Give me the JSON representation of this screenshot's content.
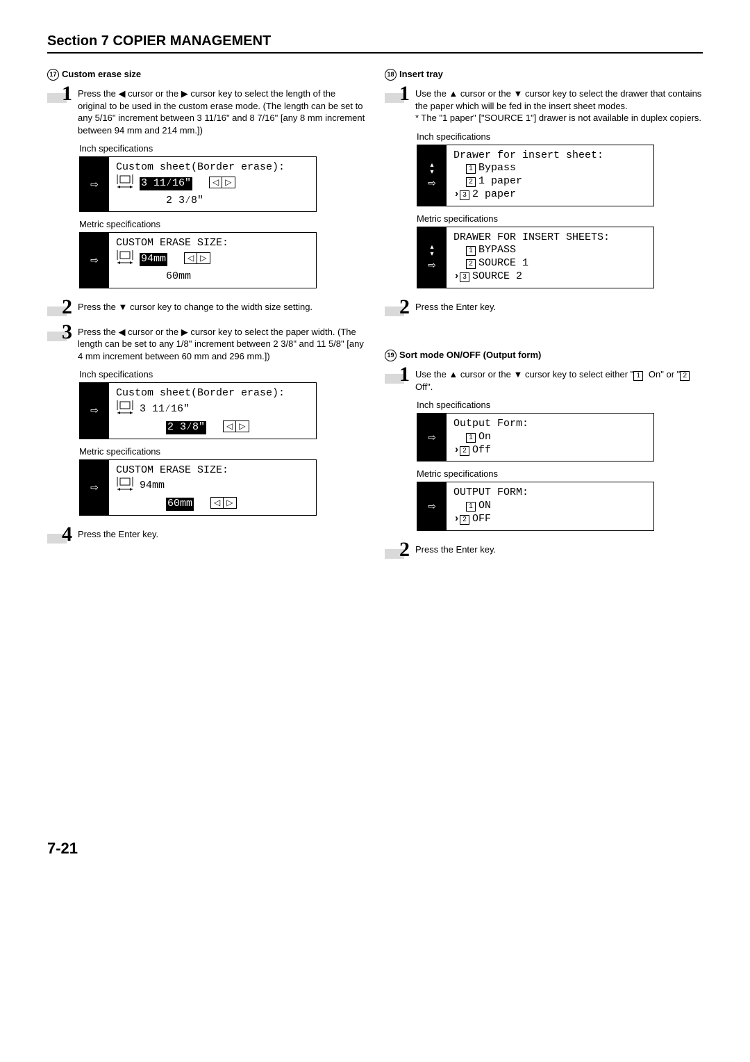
{
  "header": {
    "title": "Section 7  COPIER MANAGEMENT"
  },
  "page_number": "7-21",
  "left": {
    "subhead_num": "17",
    "subhead_text": "Custom erase size",
    "step1": "Press the ◀ cursor or the ▶ cursor key to select the length of the original to be used in the custom erase mode. (The length can be set to any 5/16\" increment between 3 11/16\" and 8 7/16\" [any 8 mm increment between 94 mm and 214 mm.])",
    "spec_inch": "Inch specifications",
    "lcd1_title": "Custom sheet(Border erase):",
    "lcd1_v1": "3 11⁄16\"",
    "lcd1_v2": "2 3⁄8\"",
    "spec_metric": "Metric specifications",
    "lcd2_title": "CUSTOM ERASE SIZE:",
    "lcd2_v1": "94mm",
    "lcd2_v2": "60mm",
    "step2": "Press the ▼ cursor key to change to the width size setting.",
    "step3": "Press the ◀ cursor or the ▶ cursor key to select the paper width. (The length can be set to any 1/8\" increment between 2 3/8\" and 11 5/8\" [any 4 mm increment between 60 mm and 296 mm.])",
    "lcd3_title": "Custom sheet(Border erase):",
    "lcd3_v1": "3 11⁄16\"",
    "lcd3_v2": "2 3⁄8\"",
    "lcd4_title": "CUSTOM ERASE SIZE:",
    "lcd4_v1": "94mm",
    "lcd4_v2": "60mm",
    "step4": "Press the Enter key."
  },
  "right": {
    "subheadA_num": "18",
    "subheadA_text": "Insert tray",
    "stepA1": "Use the ▲ cursor or the ▼ cursor key to select the drawer that contains the paper which will be fed in the insert sheet modes.",
    "stepA1_note": "* The \"1 paper\" [\"SOURCE 1\"] drawer is not available in duplex copiers.",
    "spec_inch": "Inch specifications",
    "lcdA1_title": "Drawer for insert sheet:",
    "lcdA1_o1": "Bypass",
    "lcdA1_o2": "1 paper",
    "lcdA1_o3": "2 paper",
    "spec_metric": "Metric specifications",
    "lcdA2_title": "DRAWER FOR INSERT SHEETS:",
    "lcdA2_o1": "BYPASS",
    "lcdA2_o2": "SOURCE 1",
    "lcdA2_o3": "SOURCE 2",
    "stepA2": "Press the Enter key.",
    "subheadB_num": "19",
    "subheadB_text": "Sort mode ON/OFF (Output form)",
    "stepB1_a": "Use the ▲ cursor or the ▼ cursor key to select either \"",
    "stepB1_b": " On\" or \"",
    "stepB1_c": " Off\".",
    "lcdB1_title": "Output Form:",
    "lcdB1_o1": "On",
    "lcdB1_o2": "Off",
    "lcdB2_title": "OUTPUT FORM:",
    "lcdB2_o1": "ON",
    "lcdB2_o2": "OFF",
    "stepB2": "Press the Enter key."
  }
}
